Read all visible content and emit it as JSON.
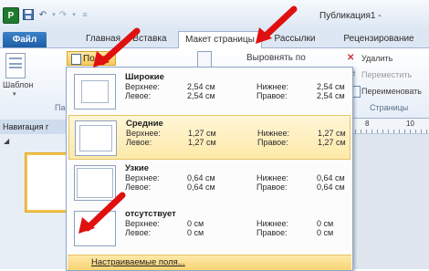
{
  "window": {
    "title": "Публикация1 -",
    "app_icon_letter": "P"
  },
  "tabs": {
    "file": "Файл",
    "home": "Главная",
    "insert": "Вставка",
    "page_layout": "Макет страницы",
    "mailings": "Рассылки",
    "review": "Рецензирование"
  },
  "ribbon": {
    "templates_label": "Шаблон",
    "margins_button": "Поля",
    "align_to": "Выровнять по",
    "delete": "Удалить",
    "move": "Переместить",
    "rename": "Переименовать",
    "pages_group": "Страницы",
    "partial_group_label": "Па"
  },
  "nav": {
    "header": "Навигация г",
    "collapse_glyph": "◢"
  },
  "ruler": {
    "marks": [
      "8",
      "10"
    ]
  },
  "margins_menu": {
    "options": [
      {
        "title": "Широкие",
        "top_label": "Верхнее:",
        "top": "2,54 см",
        "bottom_label": "Нижнее:",
        "bottom": "2,54 см",
        "left_label": "Левое:",
        "left": "2,54 см",
        "right_label": "Правое:",
        "right": "2,54 см"
      },
      {
        "title": "Средние",
        "top_label": "Верхнее:",
        "top": "1,27 см",
        "bottom_label": "Нижнее:",
        "bottom": "1,27 см",
        "left_label": "Левое:",
        "left": "1,27 см",
        "right_label": "Правое:",
        "right": "1,27 см"
      },
      {
        "title": "Узкие",
        "top_label": "Верхнее:",
        "top": "0,64 см",
        "bottom_label": "Нижнее:",
        "bottom": "0,64 см",
        "left_label": "Левое:",
        "left": "0,64 см",
        "right_label": "Правое:",
        "right": "0,64 см"
      },
      {
        "title": "отсутствует",
        "top_label": "Верхнее:",
        "top": "0 см",
        "bottom_label": "Нижнее:",
        "bottom": "0 см",
        "left_label": "Левое:",
        "left": "0 см",
        "right_label": "Правое:",
        "right": "0 см"
      }
    ],
    "custom": "Настраиваемые поля..."
  },
  "colors": {
    "arrow": "#e01010",
    "selection": "#fde9a8",
    "file_tab": "#2a6cb6"
  }
}
